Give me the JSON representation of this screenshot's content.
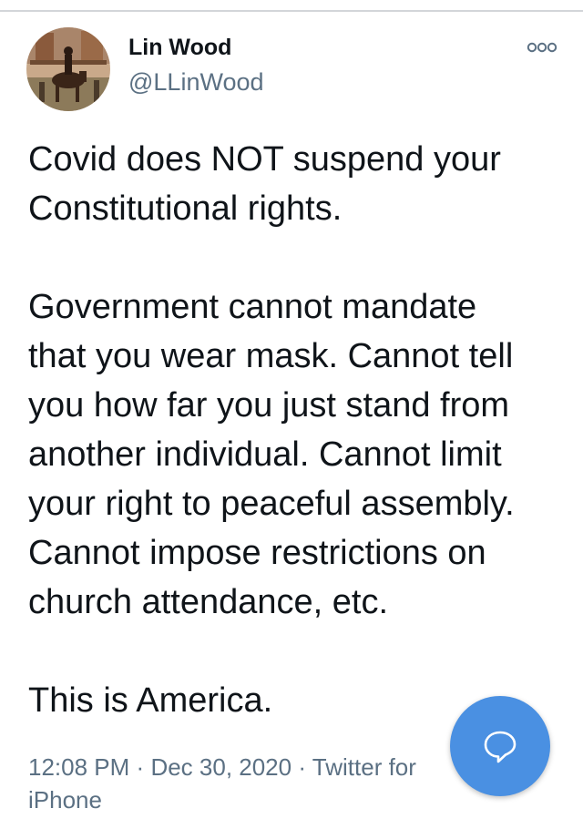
{
  "tweet": {
    "author": {
      "display_name": "Lin Wood",
      "handle": "@LLinWood",
      "avatar_icon": "avatar-horse-rider"
    },
    "more_icon": "more-icon",
    "text": {
      "para1_line1": "Covid does NOT suspend your",
      "para1_line2": "Constitutional rights.",
      "para2_line1": "Government cannot mandate",
      "para2_line2": "that you wear mask. Cannot tell",
      "para2_line3": "you how far you just stand from",
      "para2_line4": "another individual. Cannot limit",
      "para2_line5": "your right to peaceful assembly.",
      "para2_line6": "Cannot impose restrictions on",
      "para2_line7": "church attendance, etc.",
      "para3_line1": "This is America."
    },
    "meta": {
      "time": "12:08 PM",
      "separator": "·",
      "date": "Dec 30, 2020",
      "source_line1": "Twitter for",
      "source_line2": "iPhone"
    }
  },
  "fab": {
    "icon": "reply-bubble-icon",
    "color": "#4a90e2"
  },
  "colors": {
    "text_primary": "#0f1419",
    "text_secondary": "#5b7083",
    "divider": "#d3d6d9",
    "accent": "#4a90e2"
  }
}
